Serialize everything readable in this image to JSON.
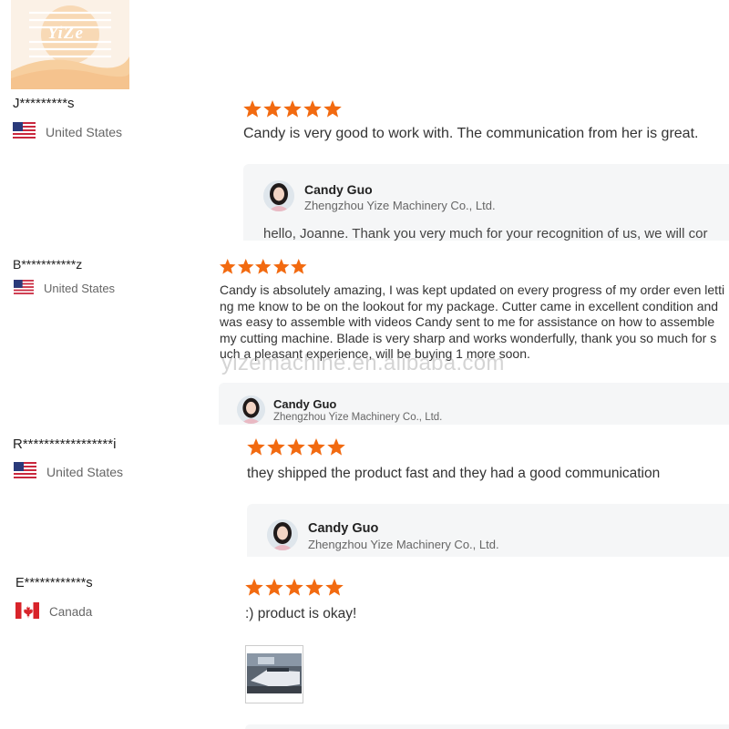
{
  "logo": {
    "text": "YiZe"
  },
  "colors": {
    "star": "#f26a10",
    "reply_bg": "#f5f6f7",
    "logo_accent": "#f5c38e"
  },
  "watermark": "yizemachine.en.alibaba.com",
  "reviews": [
    {
      "name": "J*********s",
      "country": "United States",
      "flag": "us",
      "rating": 5,
      "text": "Candy is very good to work with. The communication from her is great.",
      "reply": {
        "seller": "Candy Guo",
        "company": "Zhengzhou Yize Machinery Co., Ltd.",
        "body": "hello, Joanne. Thank you very much for your recognition of us, we will cor"
      }
    },
    {
      "name": "B***********z",
      "country": "United States",
      "flag": "us",
      "rating": 5,
      "text_lines": [
        "Candy is absolutely amazing, I was kept updated on every progress of my order even letti",
        "ng me know to be on the lookout for my package. Cutter came in excellent condition and",
        "was easy to assemble with videos Candy sent to me for assistance on how to assemble",
        "my cutting machine. Blade is very sharp and works wonderfully, thank you so much for s",
        "uch a pleasant experience, will be buying 1 more soon."
      ],
      "reply": {
        "seller": "Candy Guo",
        "company": "Zhengzhou Yize Machinery Co., Ltd."
      }
    },
    {
      "name": "R*****************i",
      "country": "United States",
      "flag": "us",
      "rating": 5,
      "text": "they shipped the product fast and they had a good communication",
      "reply": {
        "seller": "Candy Guo",
        "company": "Zhengzhou Yize Machinery Co., Ltd."
      }
    },
    {
      "name": "E************s",
      "country": "Canada",
      "flag": "ca",
      "rating": 5,
      "text": ":) product is okay!",
      "has_photo": true
    }
  ]
}
